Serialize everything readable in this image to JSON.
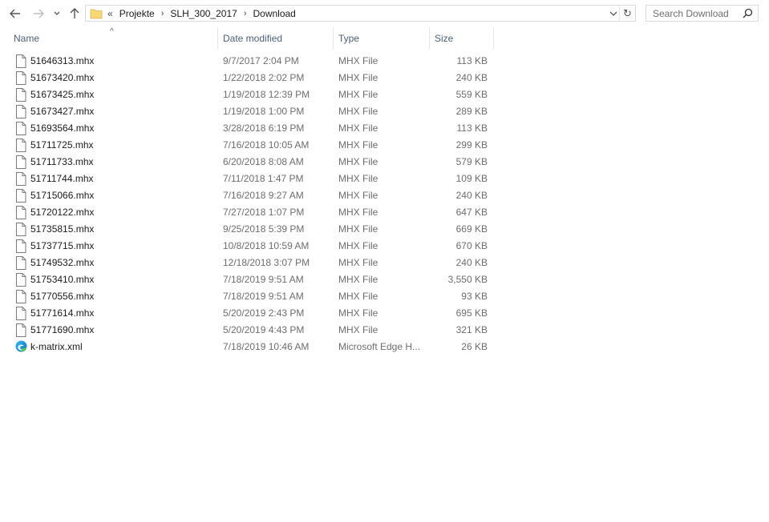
{
  "window": {
    "breadcrumb": {
      "overflow": "«",
      "items": [
        "Projekte",
        "SLH_300_2017",
        "Download"
      ]
    },
    "search": {
      "placeholder": "Search Download",
      "value": ""
    }
  },
  "columns": {
    "name": "Name",
    "date": "Date modified",
    "type": "Type",
    "size": "Size"
  },
  "files": [
    {
      "name": "51646313.mhx",
      "date": "9/7/2017 2:04 PM",
      "type": "MHX File",
      "size": "113 KB",
      "icon": "document-icon"
    },
    {
      "name": "51673420.mhx",
      "date": "1/22/2018 2:02 PM",
      "type": "MHX File",
      "size": "240 KB",
      "icon": "document-icon"
    },
    {
      "name": "51673425.mhx",
      "date": "1/19/2018 12:39 PM",
      "type": "MHX File",
      "size": "559 KB",
      "icon": "document-icon"
    },
    {
      "name": "51673427.mhx",
      "date": "1/19/2018 1:00 PM",
      "type": "MHX File",
      "size": "289 KB",
      "icon": "document-icon"
    },
    {
      "name": "51693564.mhx",
      "date": "3/28/2018 6:19 PM",
      "type": "MHX File",
      "size": "113 KB",
      "icon": "document-icon"
    },
    {
      "name": "51711725.mhx",
      "date": "7/16/2018 10:05 AM",
      "type": "MHX File",
      "size": "299 KB",
      "icon": "document-icon"
    },
    {
      "name": "51711733.mhx",
      "date": "6/20/2018 8:08 AM",
      "type": "MHX File",
      "size": "579 KB",
      "icon": "document-icon"
    },
    {
      "name": "51711744.mhx",
      "date": "7/11/2018 1:47 PM",
      "type": "MHX File",
      "size": "109 KB",
      "icon": "document-icon"
    },
    {
      "name": "51715066.mhx",
      "date": "7/16/2018 9:27 AM",
      "type": "MHX File",
      "size": "240 KB",
      "icon": "document-icon"
    },
    {
      "name": "51720122.mhx",
      "date": "7/27/2018 1:07 PM",
      "type": "MHX File",
      "size": "647 KB",
      "icon": "document-icon"
    },
    {
      "name": "51735815.mhx",
      "date": "9/25/2018 5:39 PM",
      "type": "MHX File",
      "size": "669 KB",
      "icon": "document-icon"
    },
    {
      "name": "51737715.mhx",
      "date": "10/8/2018 10:59 AM",
      "type": "MHX File",
      "size": "670 KB",
      "icon": "document-icon"
    },
    {
      "name": "51749532.mhx",
      "date": "12/18/2018 3:07 PM",
      "type": "MHX File",
      "size": "240 KB",
      "icon": "document-icon"
    },
    {
      "name": "51753410.mhx",
      "date": "7/18/2019 9:51 AM",
      "type": "MHX File",
      "size": "3,550 KB",
      "icon": "document-icon"
    },
    {
      "name": "51770556.mhx",
      "date": "7/18/2019 9:51 AM",
      "type": "MHX File",
      "size": "93 KB",
      "icon": "document-icon"
    },
    {
      "name": "51771614.mhx",
      "date": "5/20/2019 2:43 PM",
      "type": "MHX File",
      "size": "695 KB",
      "icon": "document-icon"
    },
    {
      "name": "51771690.mhx",
      "date": "5/20/2019 4:43 PM",
      "type": "MHX File",
      "size": "321 KB",
      "icon": "document-icon"
    },
    {
      "name": "k-matrix.xml",
      "date": "7/18/2019 10:46 AM",
      "type": "Microsoft Edge H...",
      "size": "26 KB",
      "icon": "edge-icon"
    }
  ],
  "colors": {
    "header_text": "#4c607a",
    "meta_text": "#6d6d6d",
    "border": "#d9d9d9",
    "folder_yellow": "#f8d775"
  }
}
